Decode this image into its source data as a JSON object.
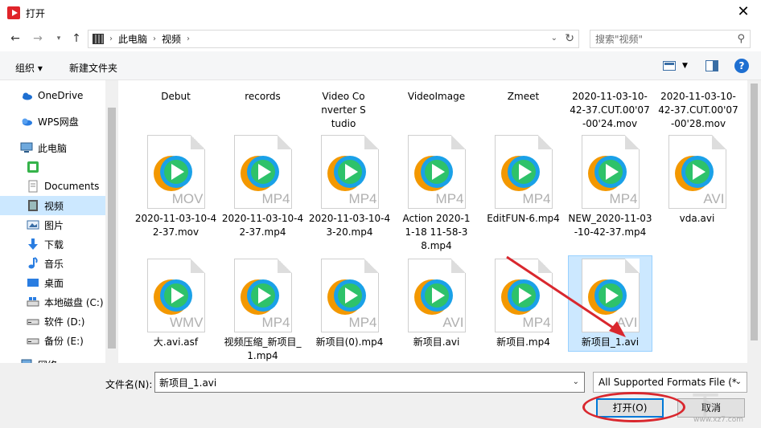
{
  "window": {
    "title": "打开"
  },
  "nav": {
    "path": [
      "此电脑",
      "视频"
    ],
    "search_placeholder": "搜索\"视频\""
  },
  "toolbar": {
    "organize": "组织 ▾",
    "new_folder": "新建文件夹"
  },
  "sidebar": {
    "items": [
      {
        "label": "OneDrive",
        "icon": "cloud-icon"
      },
      {
        "label": "WPS网盘",
        "icon": "wps-cloud-icon"
      },
      {
        "label": "此电脑",
        "icon": "computer-icon"
      },
      {
        "label": "",
        "icon": "green-app-icon"
      },
      {
        "label": "Documents",
        "icon": "documents-icon"
      },
      {
        "label": "视频",
        "icon": "video-folder-icon"
      },
      {
        "label": "图片",
        "icon": "pictures-icon"
      },
      {
        "label": "下载",
        "icon": "download-icon"
      },
      {
        "label": "音乐",
        "icon": "music-icon"
      },
      {
        "label": "桌面",
        "icon": "desktop-icon"
      },
      {
        "label": "本地磁盘 (C:)",
        "icon": "drive-icon"
      },
      {
        "label": "软件 (D:)",
        "icon": "drive-icon"
      },
      {
        "label": "备份 (E:)",
        "icon": "drive-icon"
      },
      {
        "label": "网络",
        "icon": "network-icon"
      }
    ]
  },
  "files_row1": [
    {
      "name": "Debut"
    },
    {
      "name": "records"
    },
    {
      "name": "Video Converter Studio"
    },
    {
      "name": "VideoImage"
    },
    {
      "name": "Zmeet"
    },
    {
      "name": "2020-11-03-10-42-37.CUT.00'07-00'24.mov"
    },
    {
      "name": "2020-11-03-10-42-37.CUT.00'07-00'28.mov"
    }
  ],
  "files_row2": [
    {
      "name": "2020-11-03-10-42-37.mov",
      "ext": "MOV"
    },
    {
      "name": "2020-11-03-10-42-37.mp4",
      "ext": "MP4"
    },
    {
      "name": "2020-11-03-10-43-20.mp4",
      "ext": "MP4"
    },
    {
      "name": "Action 2020-11-18 11-58-38.mp4",
      "ext": "MP4"
    },
    {
      "name": "EditFUN-6.mp4",
      "ext": "MP4"
    },
    {
      "name": "NEW_2020-11-03-10-42-37.mp4",
      "ext": "MP4"
    },
    {
      "name": "vda.avi",
      "ext": "AVI"
    }
  ],
  "files_row3": [
    {
      "name": "大.avi.asf",
      "ext": "WMV"
    },
    {
      "name": "视频压缩_新项目_1.mp4",
      "ext": "MP4"
    },
    {
      "name": "新项目(0).mp4",
      "ext": "MP4"
    },
    {
      "name": "新项目.avi",
      "ext": "AVI"
    },
    {
      "name": "新项目.mp4",
      "ext": "MP4"
    },
    {
      "name": "新项目_1.avi",
      "ext": "AVI",
      "selected": true
    }
  ],
  "bottom": {
    "filename_label": "文件名(N):",
    "filename_value": "新项目_1.avi",
    "filter_value": "All Supported Formats File (*",
    "open_button": "打开(O)",
    "cancel_button": "取消"
  },
  "watermark": {
    "text": "www.xz7.com"
  },
  "colors": {
    "accent": "#0078d7",
    "selection": "#cce8ff",
    "annotation": "#d9272e"
  }
}
